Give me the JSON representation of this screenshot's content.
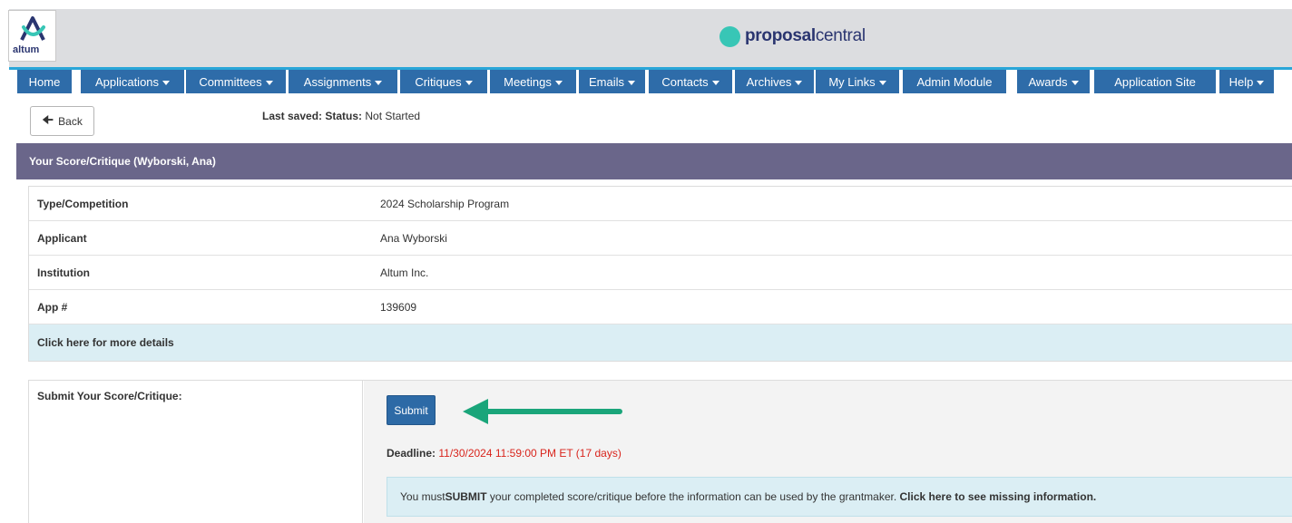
{
  "header": {
    "logo_text": "altum",
    "brand_bold": "proposal",
    "brand_light": "central"
  },
  "nav": [
    {
      "label": "Home",
      "dropdown": false
    },
    {
      "label": "Applications",
      "dropdown": true
    },
    {
      "label": "Committees",
      "dropdown": true
    },
    {
      "label": "Assignments",
      "dropdown": true
    },
    {
      "label": "Critiques",
      "dropdown": true
    },
    {
      "label": "Meetings",
      "dropdown": true
    },
    {
      "label": "Emails",
      "dropdown": true
    },
    {
      "label": "Contacts",
      "dropdown": true
    },
    {
      "label": "Archives",
      "dropdown": true
    },
    {
      "label": "My Links",
      "dropdown": true
    },
    {
      "label": "Admin Module",
      "dropdown": false
    },
    {
      "label": "Awards",
      "dropdown": true
    },
    {
      "label": "Application Site",
      "dropdown": false
    },
    {
      "label": "Help",
      "dropdown": true
    }
  ],
  "back_label": "Back",
  "status": {
    "label": "Last saved: Status:",
    "value": "Not Started"
  },
  "panel_title": "Your Score/Critique (Wyborski, Ana)",
  "info_rows": [
    {
      "key": "Type/Competition",
      "value": "2024 Scholarship Program"
    },
    {
      "key": "Applicant",
      "value": "Ana Wyborski"
    },
    {
      "key": "Institution",
      "value": "Altum Inc."
    },
    {
      "key": "App #",
      "value": "139609"
    }
  ],
  "more_details": "Click here for more details",
  "submit": {
    "label": "Submit Your Score/Critique:",
    "button": "Submit",
    "deadline_label": "Deadline:",
    "deadline_value": "11/30/2024 11:59:00 PM ET (17 days)",
    "notice_pre": "You must ",
    "notice_bold": "SUBMIT",
    "notice_mid": " your completed score/critique before the information can be used by the grantmaker. ",
    "notice_link": "Click here to see missing information."
  },
  "colors": {
    "nav_bg": "#2e6ca9",
    "panel_header": "#6a668a",
    "accent_teal": "#38c6b6",
    "arrow_green": "#1aa57a",
    "deadline_red": "#d9251d"
  }
}
